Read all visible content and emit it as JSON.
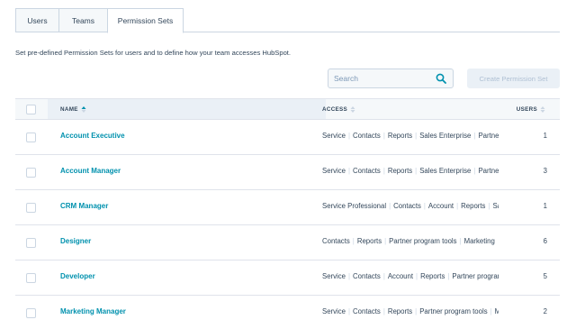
{
  "tabs": [
    {
      "label": "Users"
    },
    {
      "label": "Teams"
    },
    {
      "label": "Permission Sets",
      "active": true
    }
  ],
  "description": "Set pre-defined Permission Sets for users and to define how your team accesses HubSpot.",
  "search": {
    "placeholder": "Search",
    "icon": "search-icon"
  },
  "create_button": {
    "label": "Create Permission Set",
    "disabled": true
  },
  "table": {
    "columns": [
      {
        "label": "NAME",
        "sort": "ascending"
      },
      {
        "label": "ACCESS",
        "sort": "none"
      },
      {
        "label": "USERS",
        "sort": "none"
      }
    ],
    "rows": [
      {
        "name": "Account Executive",
        "access": [
          "Service",
          "Contacts",
          "Reports",
          "Sales Enterprise",
          "Partner"
        ],
        "users": "1"
      },
      {
        "name": "Account Manager",
        "access": [
          "Service",
          "Contacts",
          "Reports",
          "Sales Enterprise",
          "Partner"
        ],
        "users": "3"
      },
      {
        "name": "CRM Manager",
        "access": [
          "Service Professional",
          "Contacts",
          "Account",
          "Reports",
          "Sal"
        ],
        "users": "1"
      },
      {
        "name": "Designer",
        "access": [
          "Contacts",
          "Reports",
          "Partner program tools",
          "Marketing"
        ],
        "users": "6"
      },
      {
        "name": "Developer",
        "access": [
          "Service",
          "Contacts",
          "Account",
          "Reports",
          "Partner prograr"
        ],
        "users": "5"
      },
      {
        "name": "Marketing Manager",
        "access": [
          "Service",
          "Contacts",
          "Reports",
          "Partner program tools",
          "M"
        ],
        "users": "2"
      }
    ]
  },
  "colors": {
    "link": "#0091ae",
    "text": "#33475b",
    "border": "#cbd6e2",
    "header_bg": "#f5f8fa",
    "sorted_column_bg": "#eaf0f6",
    "disabled_button_bg": "#eaf0f6",
    "disabled_button_text": "#b0c1d4"
  }
}
